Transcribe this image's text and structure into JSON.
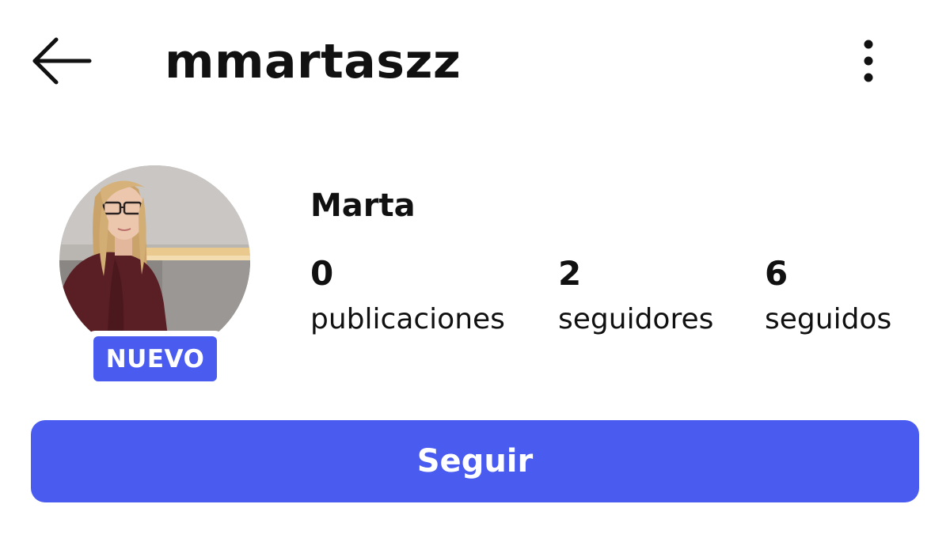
{
  "header": {
    "back_icon": "arrow-left-icon",
    "username": "mmartaszz",
    "more_icon": "more-vertical-icon"
  },
  "profile": {
    "avatar_alt": "profile photo",
    "badge": "NUEVO",
    "display_name": "Marta",
    "stats": {
      "posts": {
        "count": "0",
        "label": "publicaciones"
      },
      "followers": {
        "count": "2",
        "label": "seguidores"
      },
      "following": {
        "count": "6",
        "label": "seguidos"
      }
    }
  },
  "actions": {
    "follow_label": "Seguir"
  },
  "colors": {
    "accent": "#4a5cf0",
    "text": "#111111",
    "background": "#ffffff"
  }
}
